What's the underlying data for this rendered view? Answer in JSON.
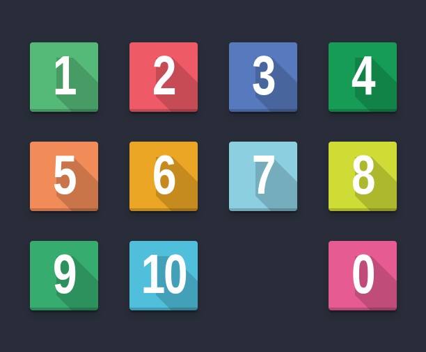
{
  "tiles": [
    {
      "label": "1",
      "color": "#55b978"
    },
    {
      "label": "2",
      "color": "#ee5a66"
    },
    {
      "label": "3",
      "color": "#5779bd"
    },
    {
      "label": "4",
      "color": "#169c55"
    },
    {
      "label": "5",
      "color": "#f18c58"
    },
    {
      "label": "6",
      "color": "#eca626"
    },
    {
      "label": "7",
      "color": "#8ccfe0"
    },
    {
      "label": "8",
      "color": "#cfdc36"
    },
    {
      "label": "9",
      "color": "#36ad6f"
    },
    {
      "label": "10",
      "color": "#4fbfdc"
    },
    {
      "label": "0",
      "color": "#e55b92"
    }
  ]
}
